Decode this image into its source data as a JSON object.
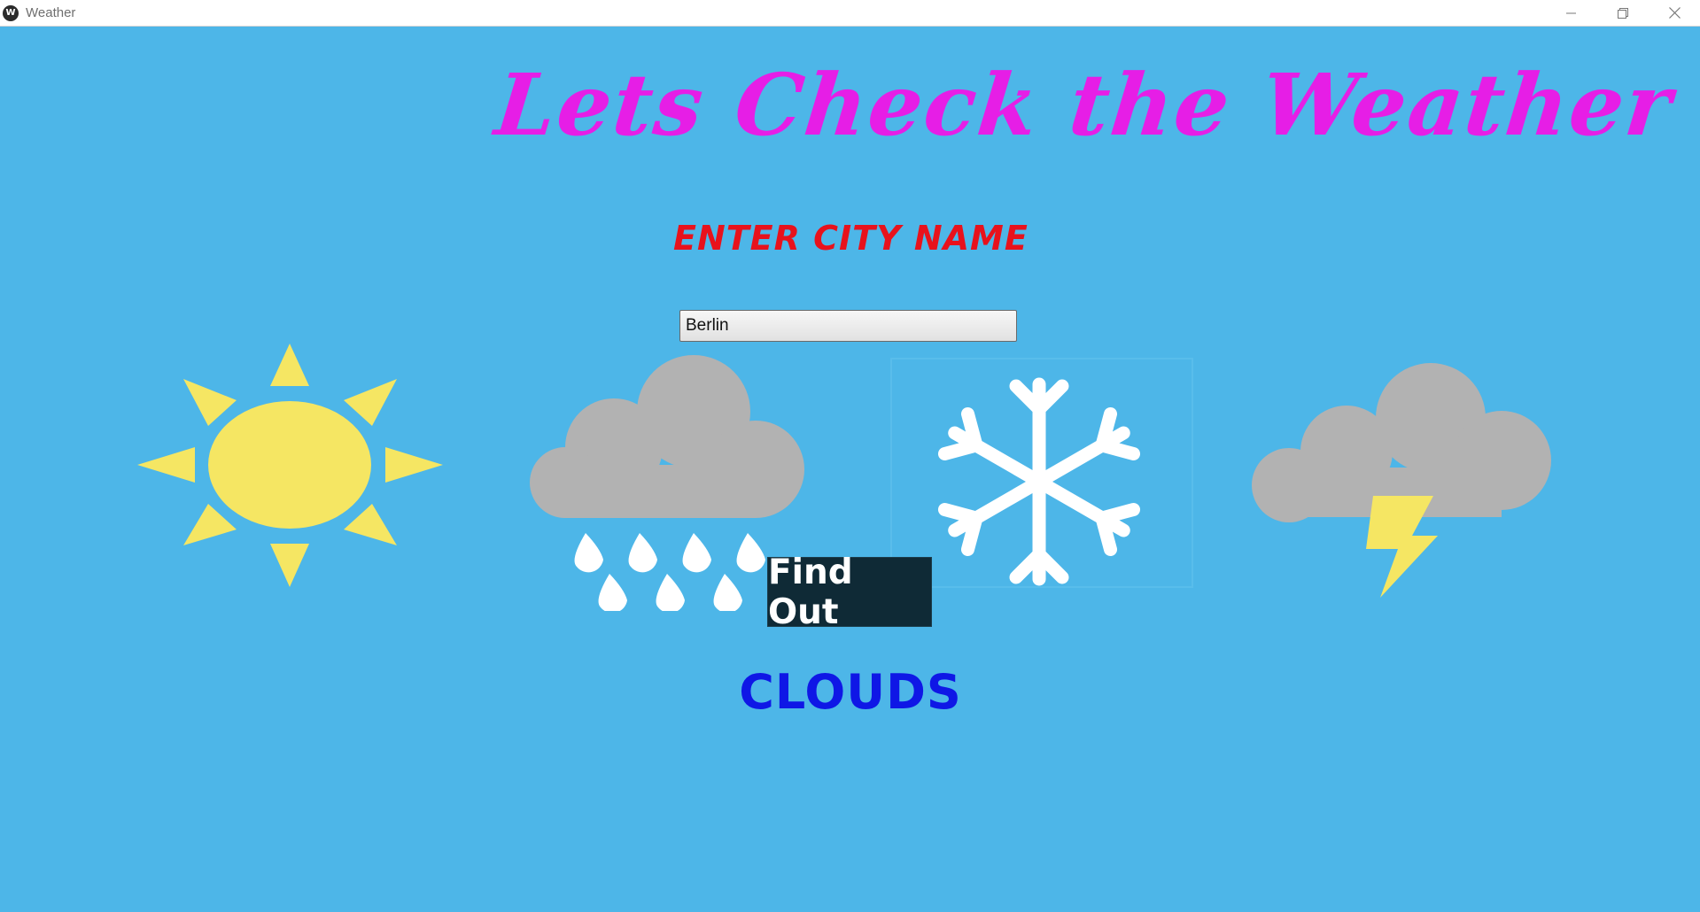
{
  "window": {
    "title": "Weather"
  },
  "heading": "Lets Check the Weather",
  "prompt": "ENTER CITY NAME",
  "search": {
    "value": "Berlin",
    "placeholder": ""
  },
  "find_button": "Find Out",
  "result": "CLOUDS",
  "icons": [
    "sun-icon",
    "rain-cloud-icon",
    "snowflake-icon",
    "thunderstorm-icon"
  ],
  "colors": {
    "background": "#4db6e8",
    "heading": "#e61ee6",
    "prompt": "#e8121c",
    "result": "#0f17e6",
    "button": "#0f2a36",
    "sun": "#f5e663",
    "cloud": "#b2b2b2"
  }
}
